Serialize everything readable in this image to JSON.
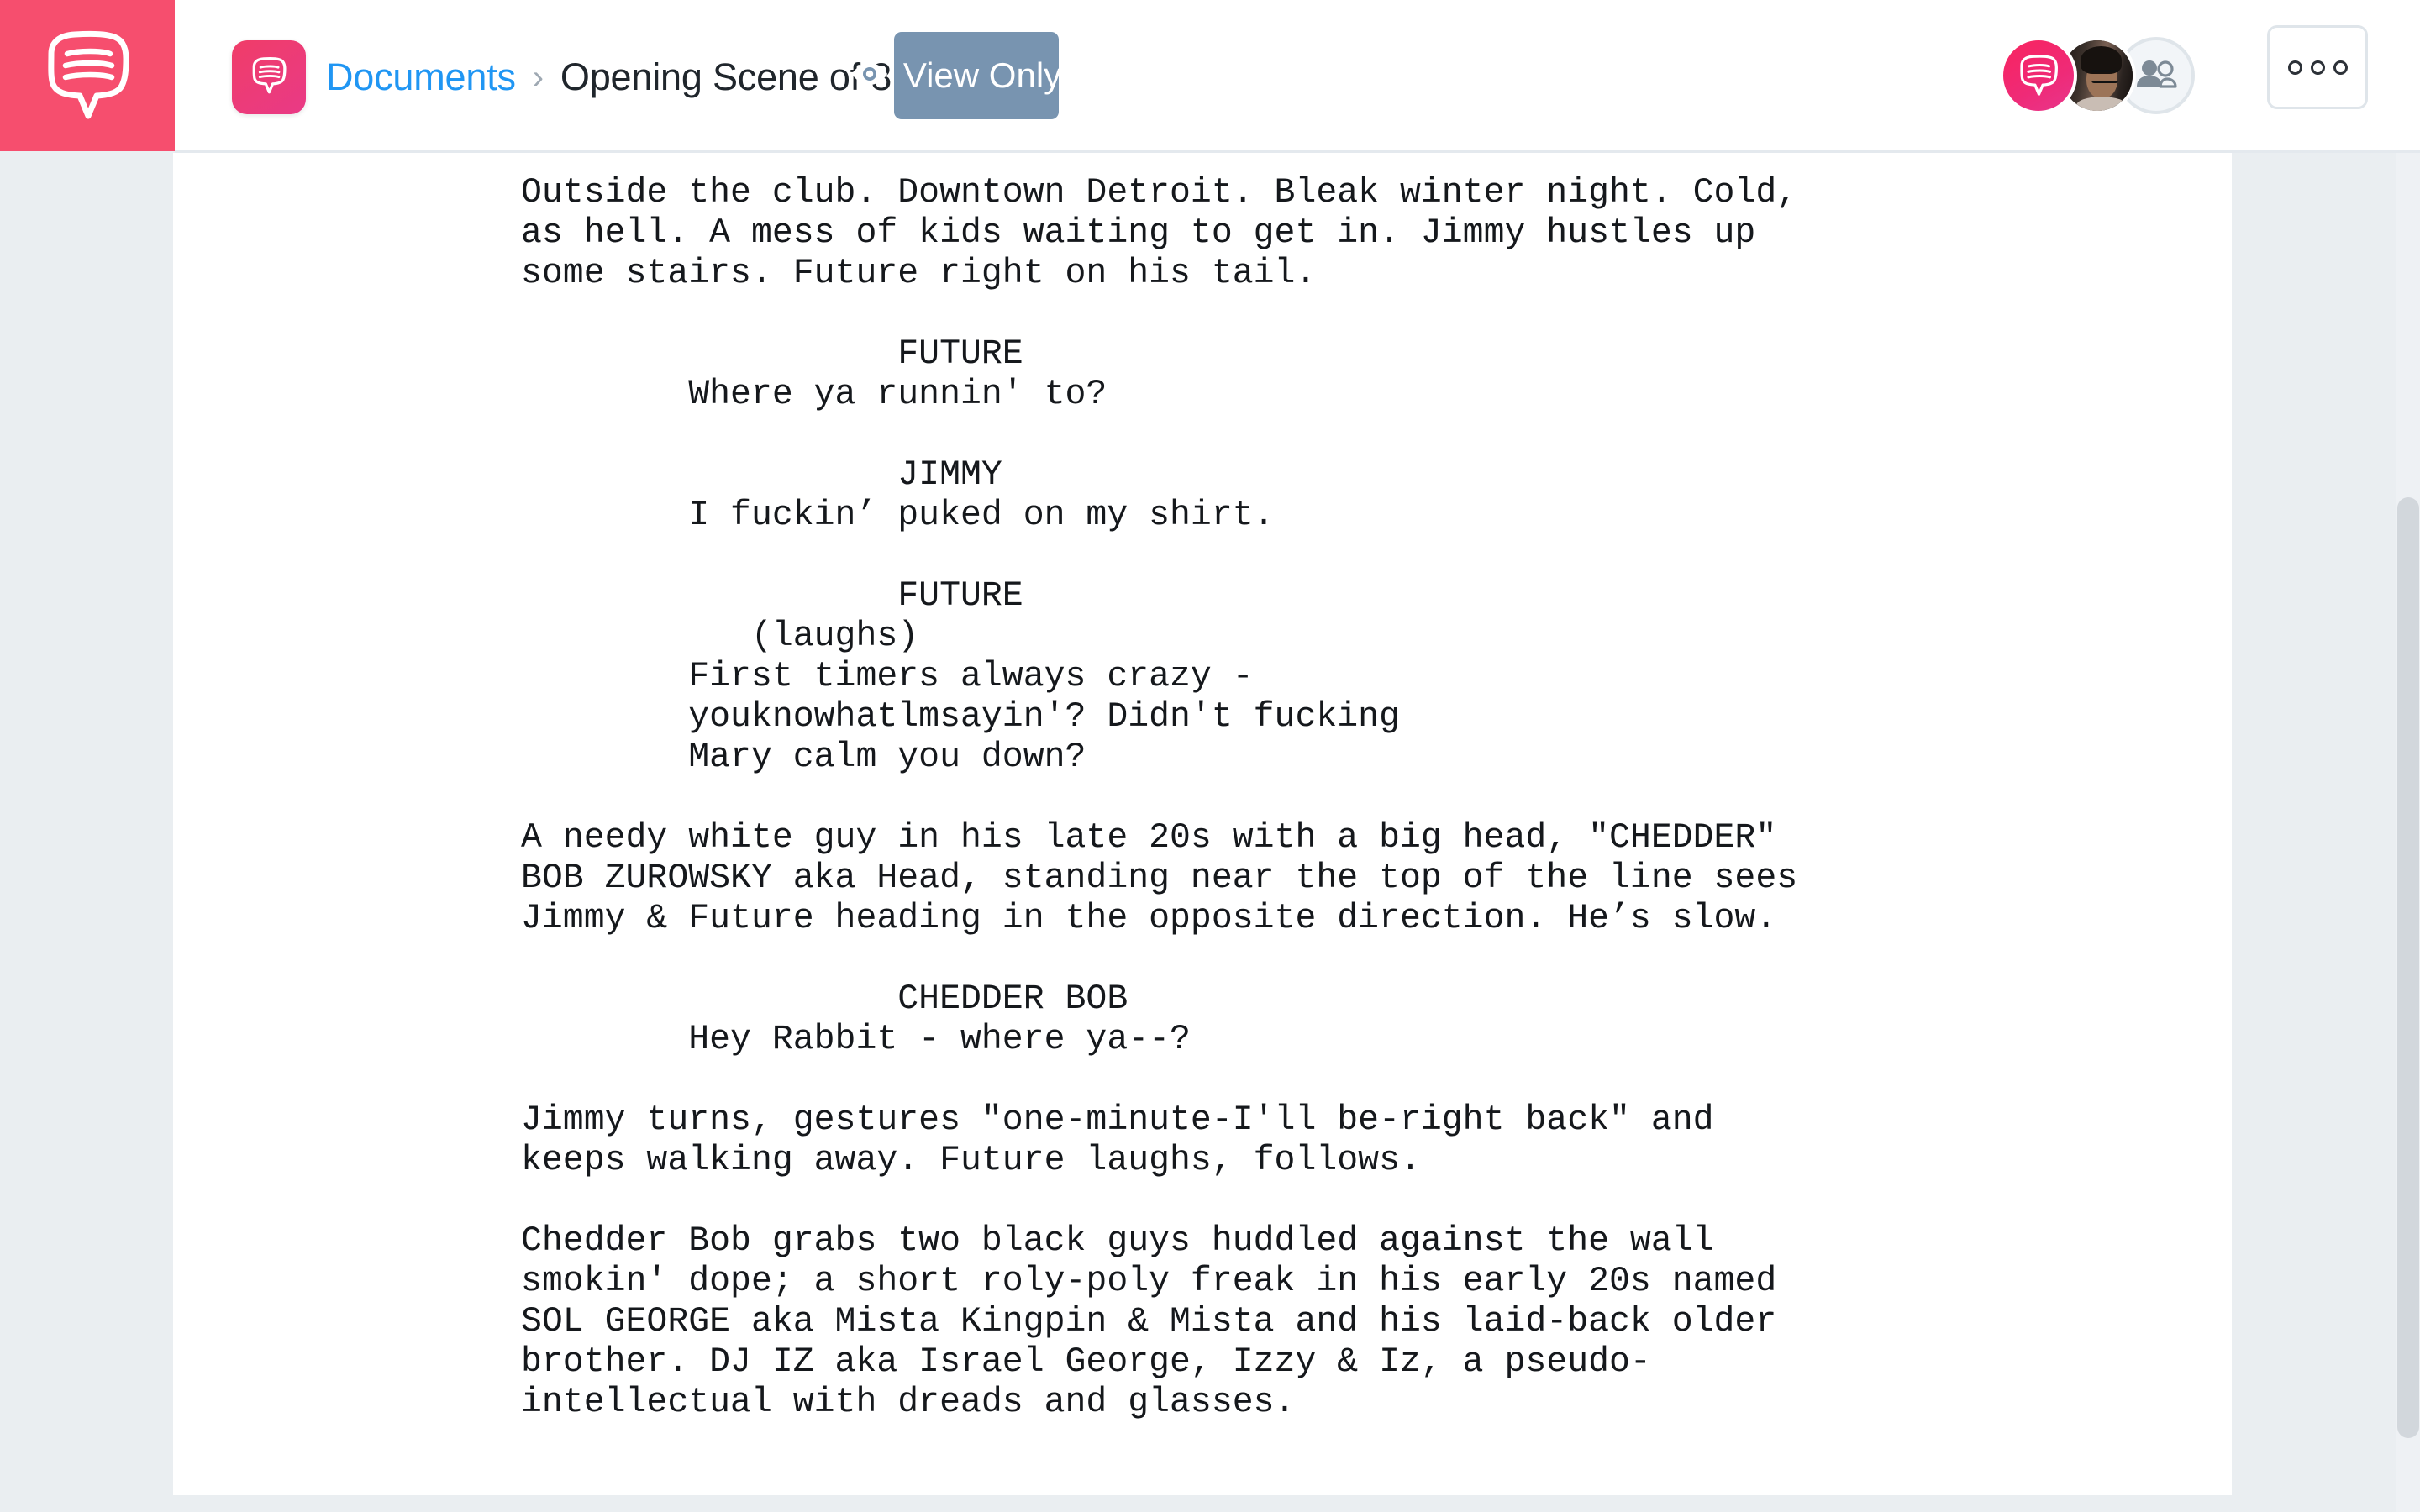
{
  "header": {
    "brand_icon": "speech-bubble-logo",
    "doc_logo_icon": "speech-bubble-icon",
    "breadcrumb": {
      "root_label": "Documents",
      "separator": "›",
      "current_label": "Opening Scene of 8.."
    },
    "view_mode_button": {
      "label": "View Only",
      "icon": "eye-icon",
      "chevron": "chevron-down-icon",
      "background_color": "#7894b0",
      "text_color": "#ffffff"
    },
    "avatars": [
      {
        "name": "brand-avatar",
        "type": "logo",
        "color": "#ef2a77"
      },
      {
        "name": "user-avatar-photo",
        "type": "photo"
      },
      {
        "name": "invite-people-avatar",
        "type": "icon",
        "icon": "people-icon",
        "color": "#7d8a96"
      }
    ],
    "more_button": {
      "label": "○○○",
      "icon": "ellipsis-icon"
    }
  },
  "theme": {
    "brand_pink": "#f64e6e",
    "link_blue": "#2096f3",
    "workspace_bg": "#eaeef1",
    "page_bg": "#ffffff",
    "text_color": "#15181c"
  },
  "document": {
    "title": "Opening Scene of 8..",
    "blocks": [
      {
        "type": "action",
        "text": "Outside the club. Downtown Detroit. Bleak winter night. Cold,\nas hell. A mess of kids waiting to get in. Jimmy hustles up\nsome stairs. Future right on his tail."
      },
      {
        "type": "character",
        "text": "                  FUTURE"
      },
      {
        "type": "dialogue",
        "text": "        Where ya runnin' to?"
      },
      {
        "type": "character",
        "text": "                  JIMMY"
      },
      {
        "type": "dialogue",
        "text": "        I fuckin’ puked on my shirt."
      },
      {
        "type": "character",
        "text": "                  FUTURE"
      },
      {
        "type": "parenthetical",
        "text": "           (laughs)"
      },
      {
        "type": "dialogue",
        "text": "        First timers always crazy -\n        youknowhatlmsayin'? Didn't fucking\n        Mary calm you down?"
      },
      {
        "type": "action",
        "text": "A needy white guy in his late 20s with a big head, \"CHEDDER\"\nBOB ZUROWSKY aka Head, standing near the top of the line sees\nJimmy & Future heading in the opposite direction. He’s slow."
      },
      {
        "type": "character",
        "text": "                  CHEDDER BOB"
      },
      {
        "type": "dialogue",
        "text": "        Hey Rabbit - where ya--?"
      },
      {
        "type": "action",
        "text": "Jimmy turns, gestures \"one-minute-I'll be-right back\" and\nkeeps walking away. Future laughs, follows."
      },
      {
        "type": "action",
        "text": "Chedder Bob grabs two black guys huddled against the wall\nsmokin' dope; a short roly-poly freak in his early 20s named\nSOL GEORGE aka Mista Kingpin & Mista and his laid-back older\nbrother. DJ IZ aka Israel George, Izzy & Iz, a pseudo-\nintellectual with dreads and glasses."
      }
    ]
  },
  "scrollbar": {
    "name": "vertical-scrollbar",
    "thumb_color": "#d2d7dc"
  }
}
